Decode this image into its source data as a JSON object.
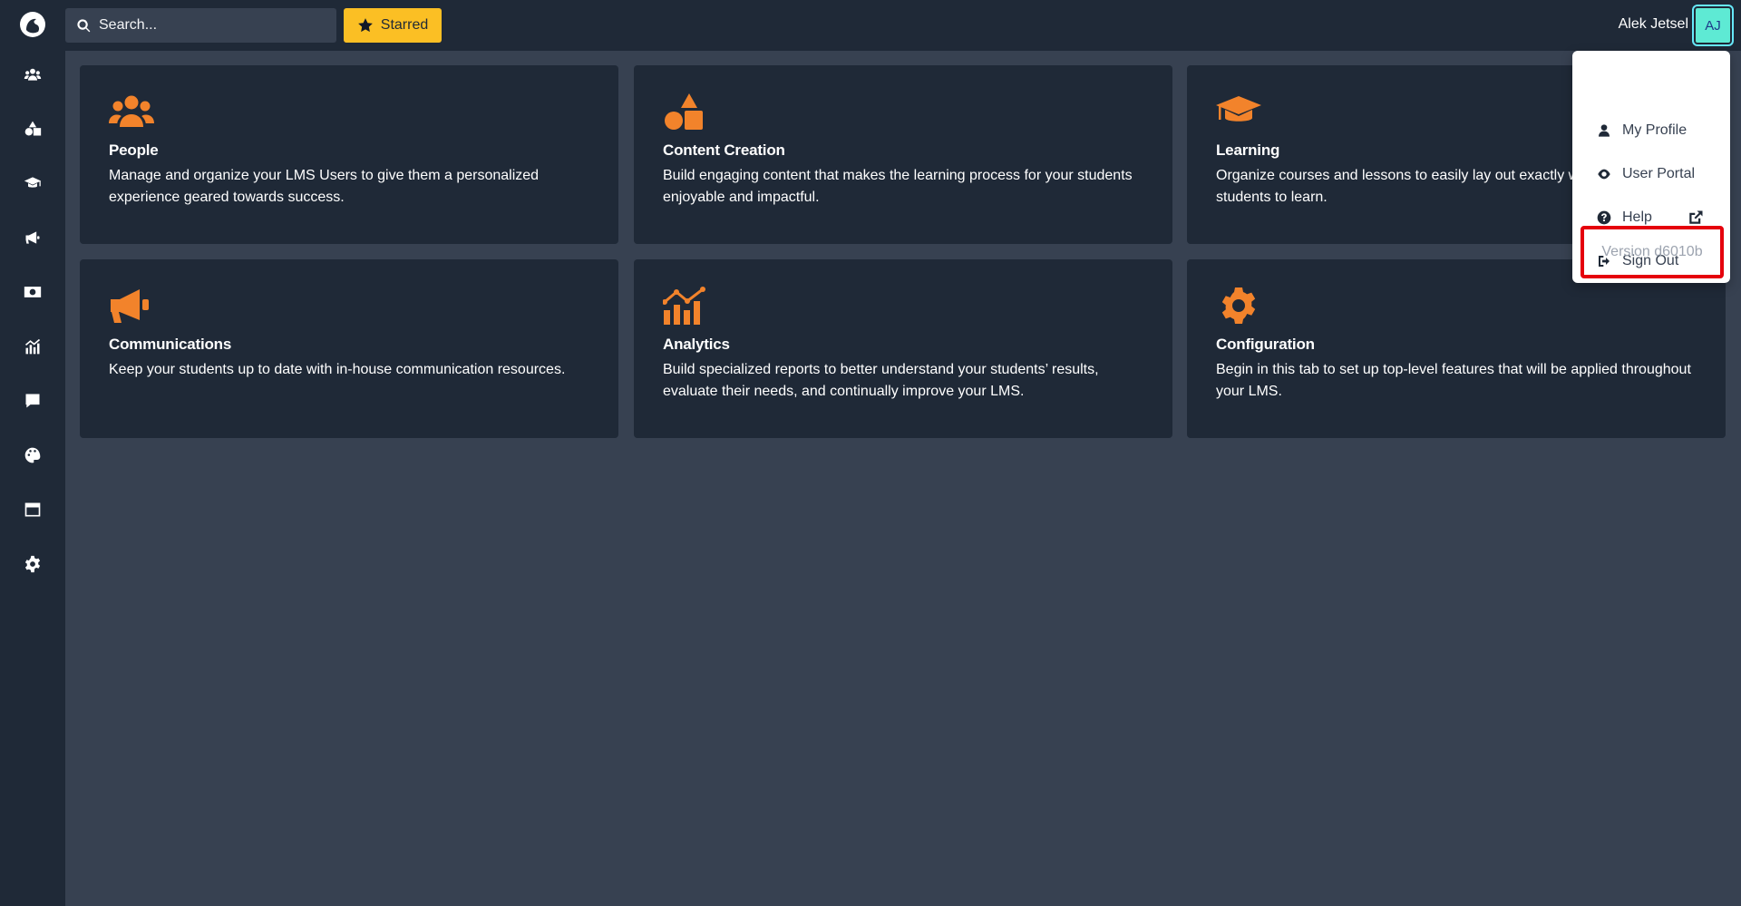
{
  "search": {
    "placeholder": "Search..."
  },
  "toolbar": {
    "starred_label": "Starred"
  },
  "user": {
    "name": "Alek Jetsel",
    "initials": "AJ"
  },
  "sidebar": {
    "items": [
      {
        "icon": "users-icon"
      },
      {
        "icon": "shapes-icon"
      },
      {
        "icon": "graduation-cap-icon"
      },
      {
        "icon": "megaphone-icon"
      },
      {
        "icon": "money-bill-icon"
      },
      {
        "icon": "chart-icon"
      },
      {
        "icon": "comment-icon"
      },
      {
        "icon": "palette-icon"
      },
      {
        "icon": "window-icon"
      },
      {
        "icon": "gear-icon"
      }
    ]
  },
  "cards": [
    {
      "title": "People",
      "description": "Manage and organize your LMS Users to give them a personalized experience geared towards success.",
      "icon": "users-icon"
    },
    {
      "title": "Content Creation",
      "description": "Build engaging content that makes the learning process for your students enjoyable and impactful.",
      "icon": "shapes-icon"
    },
    {
      "title": "Learning",
      "description": "Organize courses and lessons to easily lay out exactly what you want your students to learn.",
      "icon": "graduation-cap-icon"
    },
    {
      "title": "Communications",
      "description": "Keep your students up to date with in-house communication resources.",
      "icon": "megaphone-icon"
    },
    {
      "title": "Analytics",
      "description": "Build specialized reports to better understand your students’ results, evaluate their needs, and continually improve your LMS.",
      "icon": "chart-icon"
    },
    {
      "title": "Configuration",
      "description": "Begin in this tab to set up top-level features that will be applied throughout your LMS.",
      "icon": "gear-icon"
    }
  ],
  "user_menu": {
    "items": [
      {
        "label": "My Profile",
        "icon": "user-icon"
      },
      {
        "label": "User Portal",
        "icon": "eye-icon"
      },
      {
        "label": "Help",
        "icon": "question-circle-icon"
      },
      {
        "label": "Sign Out",
        "icon": "sign-out-icon"
      }
    ],
    "version": "Version d6010b"
  },
  "colors": {
    "accent": "#f2832b",
    "starred": "#fbbf24",
    "panel": "#1f2937",
    "background": "#374151",
    "highlight": "#e5000c"
  }
}
